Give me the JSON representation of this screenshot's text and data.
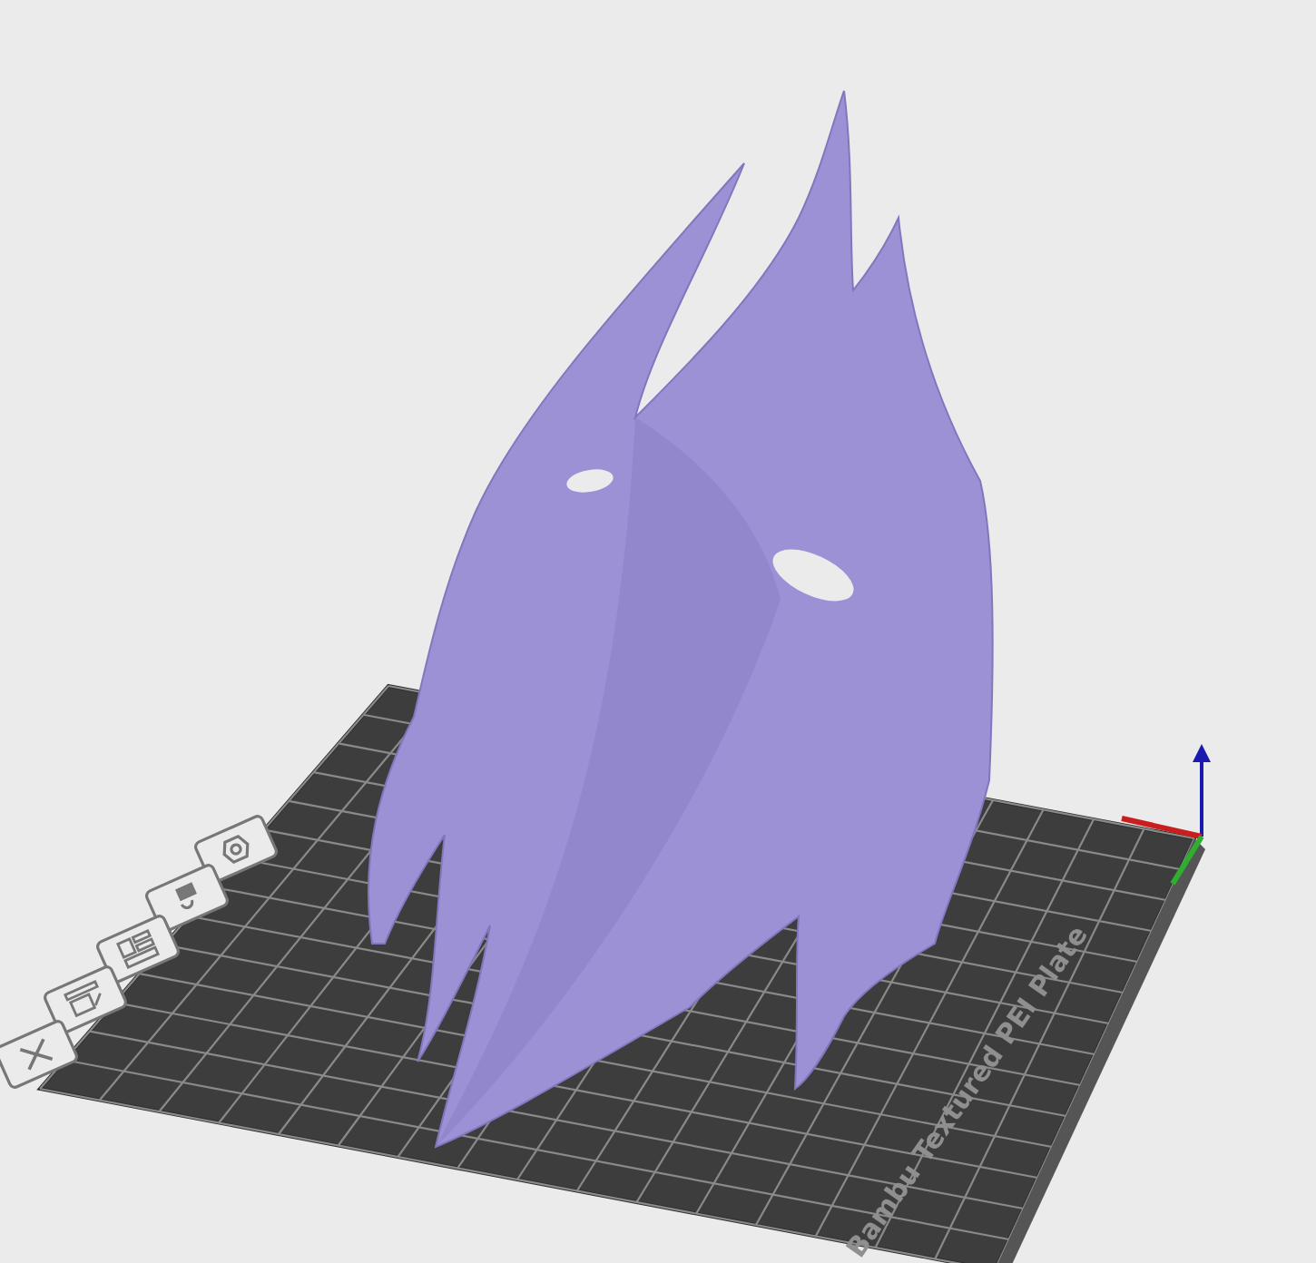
{
  "viewport": {
    "plate_label": "Bambu Textured PEI Plate"
  }
}
